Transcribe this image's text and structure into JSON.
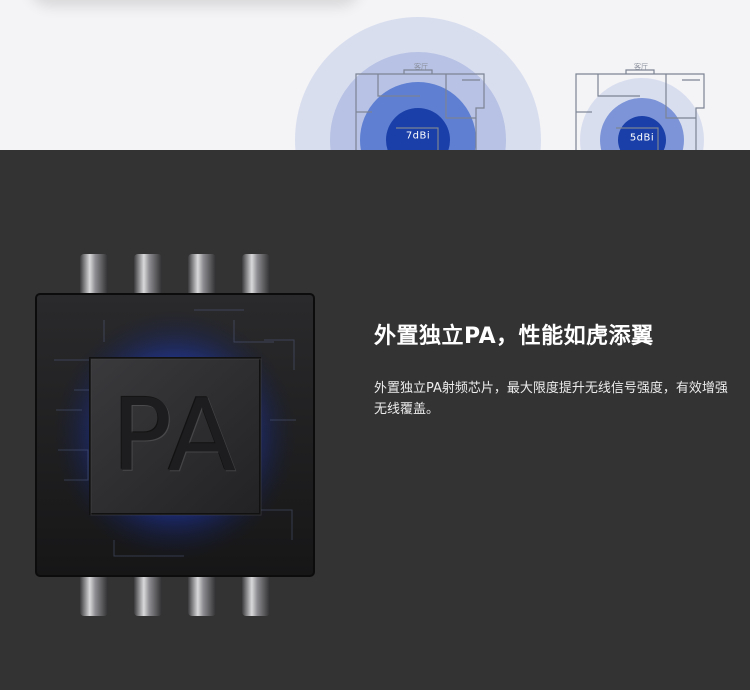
{
  "signal_diagrams": [
    {
      "gain_label": "7dBi",
      "room_label": "客厅"
    },
    {
      "gain_label": "5dBi",
      "room_label": "客厅"
    }
  ],
  "chip": {
    "label": "PA"
  },
  "feature": {
    "title": "外置独立PA，性能如虎添翼",
    "description": "外置独立PA射频芯片，最大限度提升无线信号强度，有效增强无线覆盖。"
  },
  "colors": {
    "top_background": "#f4f4f6",
    "dark_background": "#333333",
    "signal_core": "#1a3fa8",
    "chip_glow": "#1e4dff"
  }
}
